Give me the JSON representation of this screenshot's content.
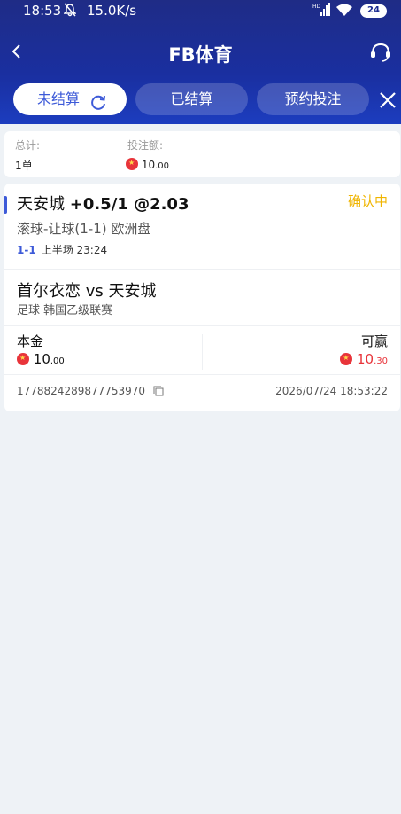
{
  "status_bar": {
    "time": "18:53",
    "speed": "15.0K/s",
    "battery": "24"
  },
  "nav": {
    "title": "FB体育"
  },
  "tabs": {
    "unsettled": "未结算",
    "settled": "已结算",
    "reserved": "预约投注"
  },
  "summary": {
    "total_label": "总计:",
    "total_value": "1单",
    "amount_label": "投注额:",
    "amount_int": "10",
    "amount_dec": ".00"
  },
  "bet": {
    "team": "天安城",
    "handicap_odds": "+0.5/1 @2.03",
    "status": "确认中",
    "market": "滚球-让球(1-1) 欧洲盘",
    "score": "1-1",
    "period_time": "上半场 23:24",
    "match": "首尔衣恋 vs 天安城",
    "league": "足球   韩国乙级联赛",
    "principal_label": "本金",
    "principal_int": "10",
    "principal_dec": ".00",
    "win_label": "可赢",
    "win_int": "10",
    "win_dec": ".30",
    "order_id": "1778824289877753970",
    "datetime": "2026/07/24 18:53:22"
  },
  "colors": {
    "header": "#1f2c86",
    "accent": "#3d5ad8",
    "status_confirm": "#f0b500",
    "win": "#e8343a"
  },
  "icons": [
    "mute-icon",
    "signal-icon",
    "wifi-icon",
    "battery-icon",
    "back-icon",
    "support-icon",
    "refresh-icon",
    "close-icon",
    "coin-icon",
    "copy-icon"
  ]
}
